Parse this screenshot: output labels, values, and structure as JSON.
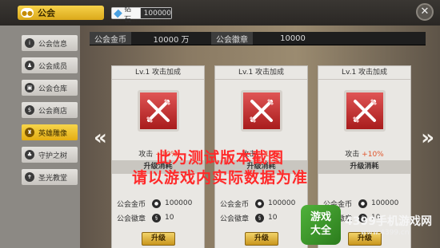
{
  "header": {
    "guild_tab_label": "公会",
    "diamond_label": "钻石",
    "diamond_value": "100000",
    "close_icon": "close-icon"
  },
  "sidebar": {
    "items": [
      {
        "label": "公会信息",
        "icon": "info-icon"
      },
      {
        "label": "公会成员",
        "icon": "members-icon"
      },
      {
        "label": "公会仓库",
        "icon": "warehouse-icon"
      },
      {
        "label": "公会商店",
        "icon": "shop-icon"
      },
      {
        "label": "英雄雕像",
        "icon": "statue-icon",
        "active": true
      },
      {
        "label": "守护之树",
        "icon": "tree-icon"
      },
      {
        "label": "圣光教堂",
        "icon": "church-icon"
      }
    ]
  },
  "stats": {
    "gold_label": "公会金币",
    "gold_value": "10000 万",
    "badge_label": "公会徽章",
    "badge_value": "10000"
  },
  "cards": [
    {
      "title": "Lv.1  攻击加成",
      "bonus_label": "攻击",
      "bonus_value": "+10%",
      "upgrade_title": "升级消耗",
      "cost_gold_label": "公会金币",
      "cost_gold_value": "100000",
      "cost_badge_label": "公会徽章",
      "cost_badge_value": "10",
      "button_label": "升级"
    },
    {
      "title": "Lv.1  攻击加成",
      "bonus_label": "攻击",
      "bonus_value": "+10%",
      "upgrade_title": "升级消耗",
      "cost_gold_label": "公会金币",
      "cost_gold_value": "100000",
      "cost_badge_label": "公会徽章",
      "cost_badge_value": "10",
      "button_label": "升级"
    },
    {
      "title": "Lv.1  攻击加成",
      "bonus_label": "攻击",
      "bonus_value": "+10%",
      "upgrade_title": "升级消耗",
      "cost_gold_label": "公会金币",
      "cost_gold_value": "100000",
      "cost_badge_label": "公会徽章",
      "cost_badge_value": "10",
      "button_label": "升级"
    }
  ],
  "nav": {
    "prev_symbol": "«",
    "next_symbol": "»"
  },
  "overlay": {
    "line1": "此为测试版本截图",
    "line2": "请以游戏内实际数据为准"
  },
  "brand": {
    "logo_line1": "游戏",
    "logo_line2": "大全",
    "name": "4399手机游戏网",
    "url": "www.4399.cn"
  },
  "colors": {
    "accent": "#e5ad14",
    "overlay_text": "#ff2a2a",
    "bonus_pct": "#e0552b"
  }
}
